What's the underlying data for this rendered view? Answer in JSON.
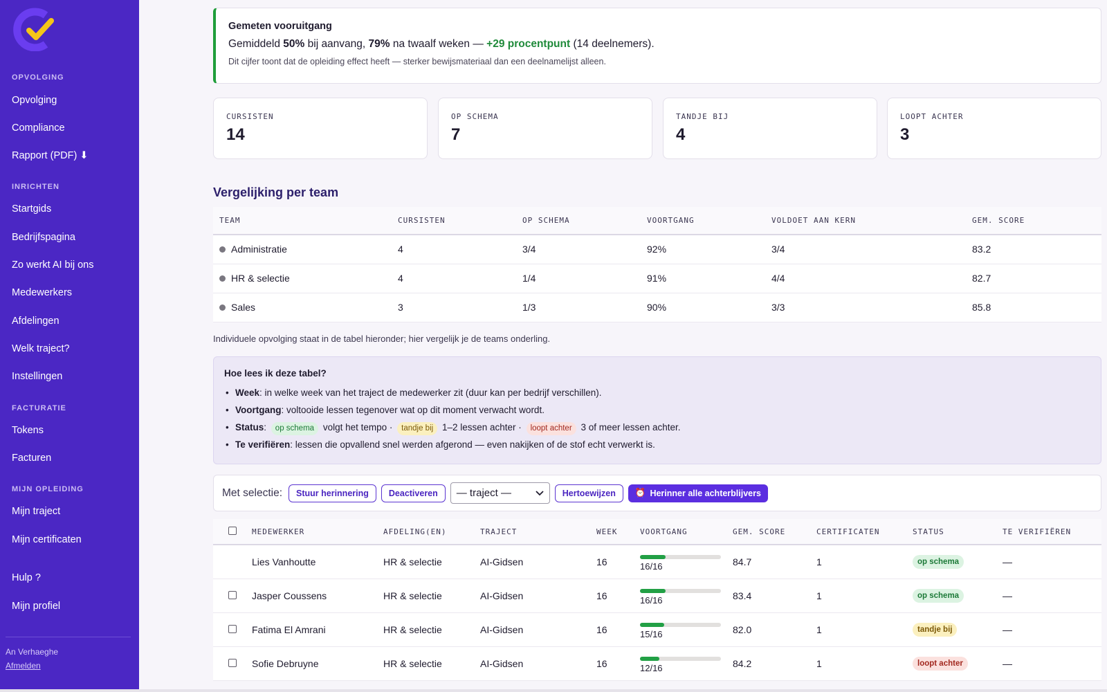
{
  "sidebar": {
    "sections": [
      {
        "title": "OPVOLGING",
        "items": [
          "Opvolging",
          "Compliance",
          "Rapport (PDF) ⬇"
        ]
      },
      {
        "title": "INRICHTEN",
        "items": [
          "Startgids",
          "Bedrijfspagina",
          "Zo werkt AI bij ons",
          "Medewerkers",
          "Afdelingen",
          "Welk traject?",
          "Instellingen"
        ]
      },
      {
        "title": "FACTURATIE",
        "items": [
          "Tokens",
          "Facturen"
        ]
      },
      {
        "title": "MIJN OPLEIDING",
        "items": [
          "Mijn traject",
          "Mijn certificaten"
        ]
      }
    ],
    "extra": [
      "Hulp ?",
      "Mijn profiel"
    ],
    "user": "An Verhaeghe",
    "logout": "Afmelden",
    "colors": {
      "background": "#4b27c4",
      "logo_ring": "#6a3df0",
      "logo_check": "#f5c518"
    }
  },
  "progress": {
    "title": "Gemeten vooruitgang",
    "prefix": "Gemiddeld",
    "start": "50%",
    "mid": "bij aanvang,",
    "end": "79%",
    "mid2": "na twaalf weken —",
    "gain": "+29 procentpunt",
    "suffix": "(14 deelnemers).",
    "note": "Dit cijfer toont dat de opleiding effect heeft — sterker bewijsmateriaal dan een deelnamelijst alleen.",
    "accent": "#1f9d3a"
  },
  "stats": [
    {
      "label": "CURSISTEN",
      "value": "14"
    },
    {
      "label": "OP SCHEMA",
      "value": "7"
    },
    {
      "label": "TANDJE BIJ",
      "value": "4"
    },
    {
      "label": "LOOPT ACHTER",
      "value": "3"
    }
  ],
  "team_section": {
    "title": "Vergelijking per team",
    "headers": [
      "TEAM",
      "CURSISTEN",
      "OP SCHEMA",
      "VOORTGANG",
      "VOLDOET AAN KERN",
      "GEM. SCORE"
    ],
    "rows": [
      [
        "Administratie",
        "4",
        "3/4",
        "92%",
        "3/4",
        "83.2"
      ],
      [
        "HR & selectie",
        "4",
        "1/4",
        "91%",
        "4/4",
        "82.7"
      ],
      [
        "Sales",
        "3",
        "1/3",
        "90%",
        "3/3",
        "85.8"
      ]
    ],
    "caption": "Individuele opvolging staat in de tabel hieronder; hier vergelijk je de teams onderling."
  },
  "help": {
    "title": "Hoe lees ik deze tabel?",
    "week_term": "Week",
    "week_text": ": in welke week van het traject de medewerker zit (duur kan per bedrijf verschillen).",
    "voortgang_term": "Voortgang",
    "voortgang_text": ": voltooide lessen tegenover wat op dit moment verwacht wordt.",
    "status_term": "Status",
    "status_colon": ":",
    "pill_green": "op schema",
    "text_green": "volgt het tempo ·",
    "pill_yellow": "tandje bij",
    "text_yellow": "1–2 lessen achter ·",
    "pill_red": "loopt achter",
    "text_red": "3 of meer lessen achter.",
    "verify_term": "Te verifiëren",
    "verify_text": ": lessen die opvallend snel werden afgerond — even nakijken of de stof echt verwerkt is."
  },
  "bulk": {
    "label": "Met selectie:",
    "remind": "Stuur herinnering",
    "deactivate": "Deactiveren",
    "select_value": "— traject —",
    "assign": "Hertoewijzen",
    "remind_all": "Herinner alle achterblijvers",
    "accent": "#5b2ee0"
  },
  "employees": {
    "headers": [
      "MEDEWERKER",
      "AFDELING(EN)",
      "TRAJECT",
      "WEEK",
      "VOORTGANG",
      "GEM. SCORE",
      "CERTIFICATEN",
      "STATUS",
      "TE VERIFIËREN"
    ],
    "rows": [
      {
        "name": "Lies Vanhoutte",
        "dept": "HR & selectie",
        "traject": "AI-Gidsen",
        "week": "16",
        "progress": "16/16",
        "progress_fraction": 0.32,
        "score": "84.7",
        "certs": "1",
        "status": "op schema",
        "status_kind": "green",
        "verify": "—",
        "checkbox": false
      },
      {
        "name": "Jasper Coussens",
        "dept": "HR & selectie",
        "traject": "AI-Gidsen",
        "week": "16",
        "progress": "16/16",
        "progress_fraction": 0.32,
        "score": "83.4",
        "certs": "1",
        "status": "op schema",
        "status_kind": "green",
        "verify": "—",
        "checkbox": true
      },
      {
        "name": "Fatima El Amrani",
        "dept": "HR & selectie",
        "traject": "AI-Gidsen",
        "week": "16",
        "progress": "15/16",
        "progress_fraction": 0.3,
        "score": "82.0",
        "certs": "1",
        "status": "tandje bij",
        "status_kind": "yellow",
        "verify": "—",
        "checkbox": true
      },
      {
        "name": "Sofie Debruyne",
        "dept": "HR & selectie",
        "traject": "AI-Gidsen",
        "week": "16",
        "progress": "12/16",
        "progress_fraction": 0.24,
        "score": "84.2",
        "certs": "1",
        "status": "loopt achter",
        "status_kind": "red",
        "verify": "—",
        "checkbox": true
      }
    ]
  }
}
